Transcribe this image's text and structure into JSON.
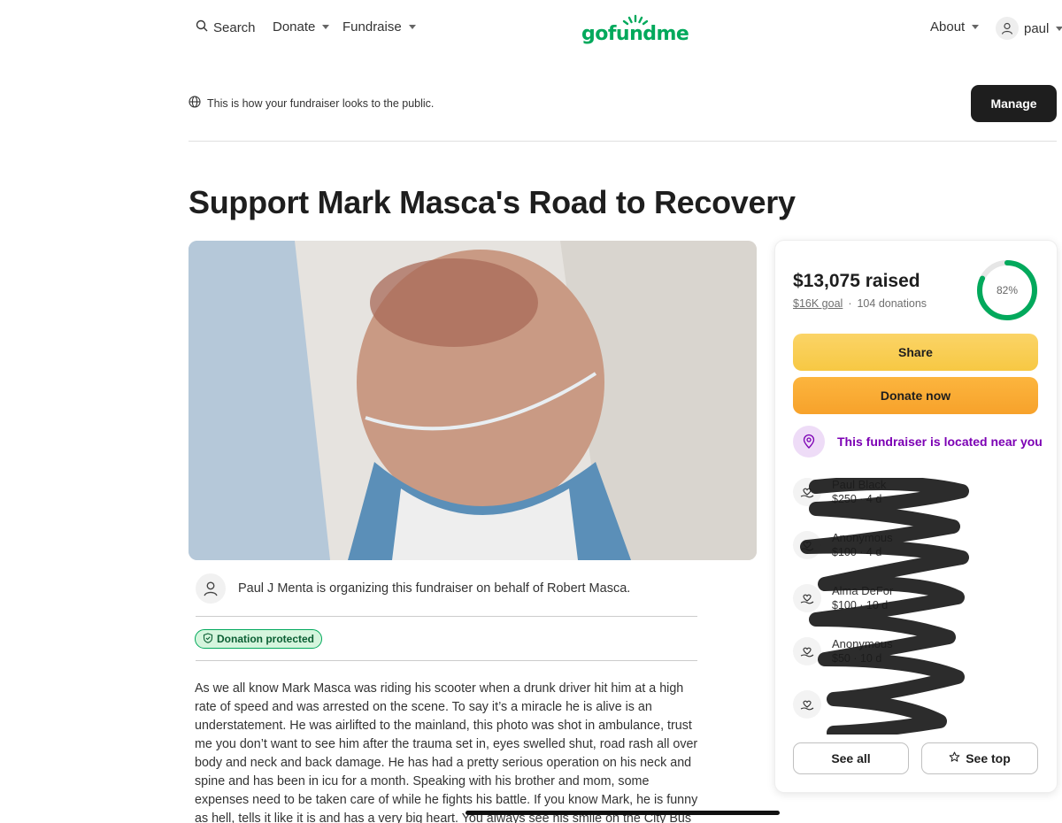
{
  "nav": {
    "search_label": "Search",
    "donate_label": "Donate",
    "fundraise_label": "Fundraise",
    "logo_text": "gofundme",
    "about_label": "About",
    "user_label": "paul"
  },
  "preview": {
    "notice": "This is how your fundraiser looks to the public.",
    "manage_label": "Manage"
  },
  "fundraiser": {
    "title": "Support Mark Masca's Road to Recovery",
    "organizer_text": "Paul J Menta is organizing this fundraiser on behalf of Robert Masca.",
    "protected_label": "Donation protected",
    "story": "As we all know Mark Masca was riding his scooter when a drunk driver hit him at a high rate of speed and was arrested on the scene. To say it’s a miracle he is alive is an understatement. He was airlifted to the mainland, this photo was shot in ambulance, trust me you don’t want to see him after the trauma set in, eyes swelled shut, road rash all over body and neck and back damage. He has had a pretty serious operation on his neck and spine and has been in icu for a month. Speaking with his brother and mom, some expenses need to be taken care of while he fights his battle. If you know Mark, he is funny as hell, tells it like it is and has a very big heart. You always see his smile on the City Bus he drives."
  },
  "card": {
    "raised": "$13,075 raised",
    "goal": "$16K goal",
    "separator": "·",
    "donations": "104 donations",
    "progress_label": "82%",
    "progress_fraction": 0.82,
    "share_label": "Share",
    "donate_label": "Donate now",
    "nearby_label": "This fundraiser is located near you",
    "donors": [
      {
        "name": "Paul Black",
        "amount": "$250 · 4 d"
      },
      {
        "name": "Anonymous",
        "amount": "$100 · 4 d"
      },
      {
        "name": "Alma DeFor",
        "amount": "$100 · 10 d"
      },
      {
        "name": "Anonymous",
        "amount": "$50 · 10 d"
      },
      {
        "name": "",
        "amount": ""
      }
    ],
    "see_all_label": "See all",
    "see_top_label": "See top"
  },
  "colors": {
    "brand_green": "#02a95c",
    "share_yellow": "#f7c843",
    "donate_orange": "#f7a22b",
    "nearby_purple": "#7c00b4"
  }
}
